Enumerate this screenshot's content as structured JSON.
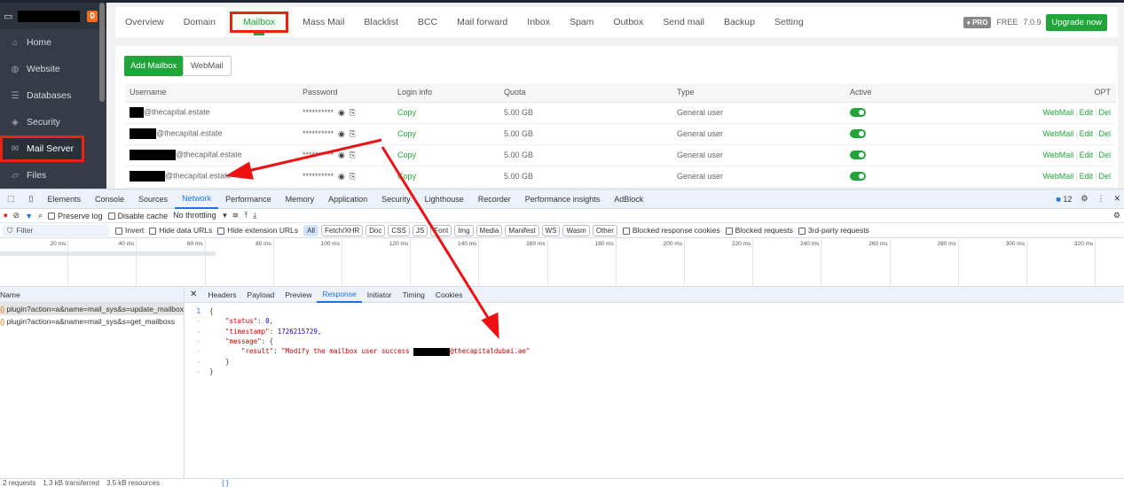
{
  "sidebar": {
    "badge": "0",
    "items": [
      {
        "label": "Home",
        "icon": "home-icon"
      },
      {
        "label": "Website",
        "icon": "globe-icon"
      },
      {
        "label": "Databases",
        "icon": "database-icon"
      },
      {
        "label": "Security",
        "icon": "shield-icon"
      },
      {
        "label": "Mail Server",
        "icon": "mail-icon"
      },
      {
        "label": "Files",
        "icon": "folder-icon"
      }
    ]
  },
  "nav": {
    "tabs": [
      "Overview",
      "Domain",
      "Mailbox",
      "Mass Mail",
      "Blacklist",
      "BCC",
      "Mail forward",
      "Inbox",
      "Spam",
      "Outbox",
      "Send mail",
      "Backup",
      "Setting"
    ],
    "pro": "PRO",
    "free": "FREE",
    "version": "7.0.9",
    "upgrade": "Upgrade now"
  },
  "toolbar": {
    "add": "Add Mailbox",
    "webmail": "WebMail"
  },
  "table": {
    "headers": [
      "Username",
      "Password",
      "Login info",
      "Quota",
      "Type",
      "Active",
      "OPT"
    ],
    "rows": [
      {
        "user": "@thecapital.estate",
        "password": "**********",
        "login": "Copy",
        "quota": "5.00 GB",
        "type": "General user"
      },
      {
        "user": "@thecapital.estate",
        "password": "**********",
        "login": "Copy",
        "quota": "5.00 GB",
        "type": "General user"
      },
      {
        "user": "@thecapital.estate",
        "password": "**********",
        "login": "Copy",
        "quota": "5.00 GB",
        "type": "General user"
      },
      {
        "user": "@thecapital.estate",
        "password": "**********",
        "login": "Copy",
        "quota": "5.00 GB",
        "type": "General user"
      }
    ],
    "ops": [
      "WebMail",
      "Edit",
      "Del"
    ]
  },
  "devtools": {
    "tabs": [
      "Elements",
      "Console",
      "Sources",
      "Network",
      "Performance",
      "Memory",
      "Application",
      "Security",
      "Lighthouse",
      "Recorder",
      "Performance insights",
      "AdBlock"
    ],
    "issues": "12",
    "toolbar": {
      "preserve": "Preserve log",
      "cache": "Disable cache",
      "throttle": "No throttling"
    },
    "filter": {
      "placeholder": "Filter",
      "invert": "Invert",
      "hide_data": "Hide data URLs",
      "hide_ext": "Hide extension URLs",
      "chips": [
        "All",
        "Fetch/XHR",
        "Doc",
        "CSS",
        "JS",
        "Font",
        "Img",
        "Media",
        "Manifest",
        "WS",
        "Wasm",
        "Other"
      ],
      "blocked_cookies": "Blocked response cookies",
      "blocked_req": "Blocked requests",
      "third": "3rd-party requests"
    },
    "ticks": [
      "20 ms",
      "40 ms",
      "60 ms",
      "80 ms",
      "100 ms",
      "120 ms",
      "140 ms",
      "160 ms",
      "180 ms",
      "200 ms",
      "220 ms",
      "240 ms",
      "260 ms",
      "280 ms",
      "300 ms",
      "320 ms"
    ],
    "name_header": "Name",
    "requests": [
      "plugin?action=a&name=mail_sys&s=update_mailbox",
      "plugin?action=a&name=mail_sys&s=get_mailboxs"
    ],
    "detail_tabs": [
      "Headers",
      "Payload",
      "Preview",
      "Response",
      "Initiator",
      "Timing",
      "Cookies"
    ],
    "response": {
      "status_key": "\"status\"",
      "status_val": "0",
      "ts_key": "\"timestamp\"",
      "ts_val": "1726215729",
      "msg_key": "\"message\"",
      "result_key": "\"result\"",
      "result_prefix": "\"Modify the mailbox user success ",
      "result_suffix": "@thecapitaldubai.ae\""
    },
    "status": {
      "requests": "2 requests",
      "transferred": "1.3 kB transferred",
      "resources": "3.5 kB resources"
    }
  },
  "colors": {
    "accent": "#20a53a",
    "annotation": "#ee1111",
    "devtools_blue": "#1a73e8"
  }
}
